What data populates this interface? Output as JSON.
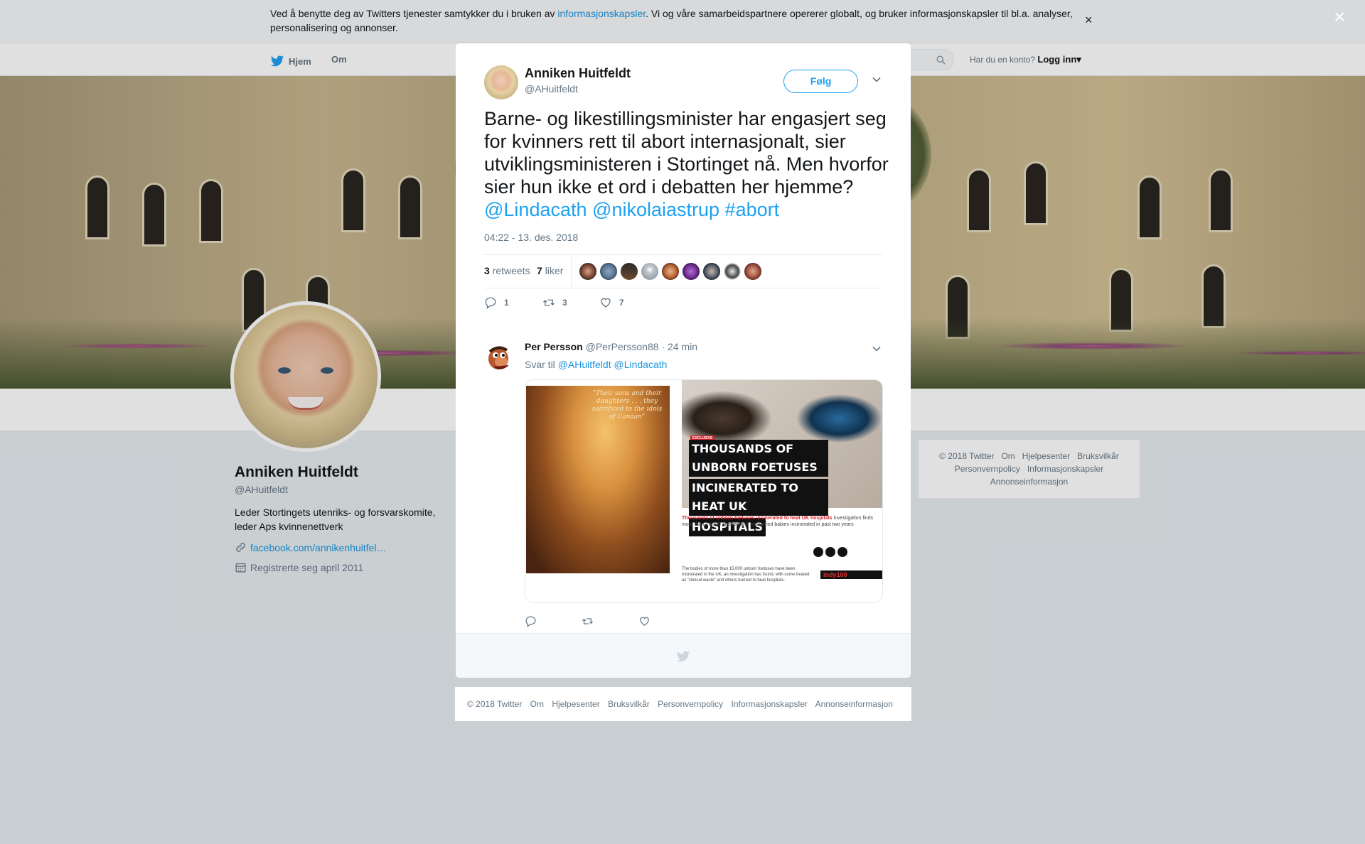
{
  "cookie": {
    "text_before": "Ved å benytte deg av Twitters tjenester samtykker du i bruken av ",
    "link": "informasjonskapsler",
    "text_after": ". Vi og våre samarbeidspartnere opererer globalt, og bruker informasjonskapsler til bl.a. analyser, personalisering og annonser.",
    "close": "×"
  },
  "nav": {
    "home": "Hjem",
    "about": "Om",
    "account_prompt": "Har du en konto?",
    "login": "Logg inn",
    "login_caret": "▾"
  },
  "profile": {
    "name": "Anniken Huitfeldt",
    "handle": "@AHuitfeldt",
    "bio": "Leder Stortingets utenriks- og forsvarskomite, leder Aps kvinnenettverk",
    "link": "facebook.com/annikenhuitfel…",
    "joined": "Registrerte seg april 2011"
  },
  "side_footer": {
    "items": [
      "© 2018 Twitter",
      "Om",
      "Hjelpesenter",
      "Bruksvilkår",
      "Personvernpolicy",
      "Informasjonskapsler",
      "Annonseinformasjon"
    ]
  },
  "modal": {
    "close": "×",
    "tweet": {
      "name": "Anniken Huitfeldt",
      "handle": "@AHuitfeldt",
      "follow": "Følg",
      "text": "Barne- og likestillingsminister har engasjert seg for kvinners rett til abort internasjonalt, sier utviklingsministeren i Stortinget nå. Men hvorfor sier hun ikke et ord i debatten her hjemme? ",
      "mention1": "@Lindacath",
      "mention2": "@nikolaiastrup",
      "hashtag": "#abort",
      "time": "04:22 - 13. des. 2018",
      "retweets_count": "3",
      "retweets_label": "retweets",
      "likes_count": "7",
      "likes_label": "liker",
      "reply_count": "1",
      "rt_count": "3",
      "like_count": "7"
    },
    "reply": {
      "name": "Per Persson",
      "handle": "@PerPersson88",
      "time": "· 24 min",
      "reply_prefix": "Svar til",
      "reply_to1": "@AHuitfeldt",
      "reply_to2": "@Lindacath",
      "media": {
        "left_caption": "\"Their sons and their daughters . . . they sacrificed to the idols of Canaan\"",
        "badge": "EXCLUSIVE",
        "headline1": "THOUSANDS OF UNBORN FOETUSES",
        "headline2": "INCINERATED TO HEAT UK",
        "headline3": "HOSPITALS",
        "red_text": "Thousands of unborn foetuses incinerated to heat UK hospitals",
        "body_text": "investigation finds more than 15,000 aborted and miscarried babies incinerated in past two years",
        "small_text": "The bodies of more than 15,000 unborn foetuses have been incinerated in the UK, an investigation has found, with some treated as \"clinical waste\" and others burned to heat hospitals.",
        "brand": "indy100"
      }
    }
  },
  "bottom_footer": {
    "items": [
      "© 2018 Twitter",
      "Om",
      "Hjelpesenter",
      "Bruksvilkår",
      "Personvernpolicy",
      "Informasjonskapsler",
      "Annonseinformasjon"
    ]
  },
  "colors": {
    "twitter_blue": "#1da1f2",
    "link_blue": "#1b95e0",
    "muted_gray": "#657786"
  }
}
